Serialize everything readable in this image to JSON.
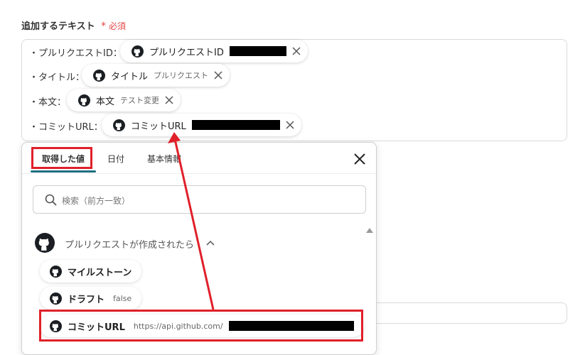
{
  "field": {
    "label": "追加するテキスト",
    "required_star": "*",
    "required_label": "必須"
  },
  "editor": {
    "lines": [
      {
        "prefix": "・プルリクエストID：",
        "pill_name": "プルリクエストID",
        "pill_value": ""
      },
      {
        "prefix": "・タイトル：",
        "pill_name": "タイトル",
        "pill_value": "プルリクエスト"
      },
      {
        "prefix": "・本文：",
        "pill_name": "本文",
        "pill_value": "テスト変更"
      },
      {
        "prefix": "・コミットURL：",
        "pill_name": "コミットURL",
        "pill_value": ""
      }
    ]
  },
  "panel": {
    "tabs": [
      "取得した値",
      "日付",
      "基本情報"
    ],
    "search_placeholder": "検索（前方一致）",
    "section_title": "プルリクエストが作成されたら",
    "items": [
      {
        "name": "マイルストーン",
        "value": ""
      },
      {
        "name": "ドラフト",
        "value": "false"
      },
      {
        "name": "コミットURL",
        "value": "https://api.github.com/"
      }
    ]
  },
  "colors": {
    "highlight": "#e0202a",
    "accent": "#1f6f7f",
    "required": "#e64545"
  },
  "icons": {
    "pill_icon": "github-icon",
    "remove": "close-icon",
    "search": "search-icon"
  }
}
